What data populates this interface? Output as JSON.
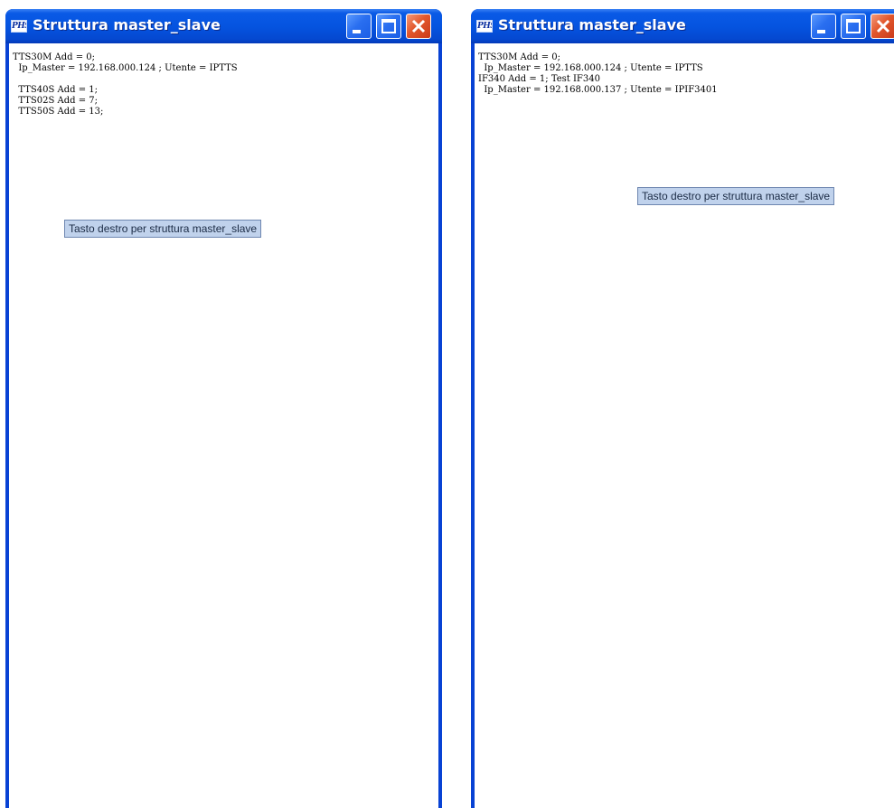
{
  "windows": [
    {
      "title": "Struttura master_slave",
      "icon_label": "PHS",
      "lines": [
        "TTS30M Add = 0;",
        "  Ip_Master = 192.168.000.124 ; Utente = IPTTS",
        "",
        "  TTS40S Add = 1;",
        "  TTS02S Add = 7;",
        "  TTS50S Add = 13;"
      ],
      "tooltip": "Tasto destro per struttura master_slave"
    },
    {
      "title": "Struttura master_slave",
      "icon_label": "PHS",
      "lines": [
        "TTS30M Add = 0;",
        "  Ip_Master = 192.168.000.124 ; Utente = IPTTS",
        "IF340 Add = 1; Test IF340",
        "  Ip_Master = 192.168.000.137 ; Utente = IPIF3401"
      ],
      "tooltip": "Tasto destro per struttura master_slave"
    }
  ],
  "colors": {
    "titlebar": "#0554e0",
    "frame": "#0842d4",
    "close_button": "#e2572c",
    "tooltip_bg": "#c0d2ec"
  },
  "icons": {
    "minimize": "minimize-icon",
    "maximize": "maximize-icon",
    "close": "close-icon"
  }
}
